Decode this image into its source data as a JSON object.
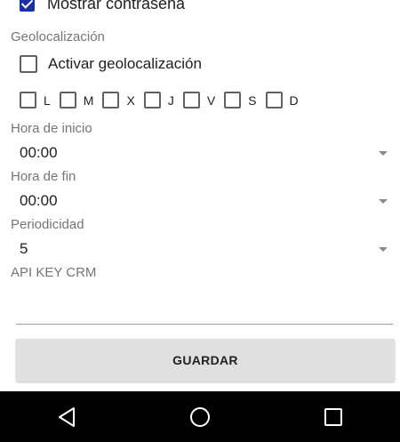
{
  "top_item": {
    "label": "Mostrar contraseña",
    "checked": true
  },
  "geolocation": {
    "section_label": "Geolocalización",
    "checkbox_label": "Activar geolocalización",
    "checked": false
  },
  "days": [
    {
      "label": "L",
      "checked": false
    },
    {
      "label": "M",
      "checked": false
    },
    {
      "label": "X",
      "checked": false
    },
    {
      "label": "J",
      "checked": false
    },
    {
      "label": "V",
      "checked": false
    },
    {
      "label": "S",
      "checked": false
    },
    {
      "label": "D",
      "checked": false
    }
  ],
  "start_time": {
    "label": "Hora de inicio",
    "value": "00:00"
  },
  "end_time": {
    "label": "Hora de fin",
    "value": "00:00"
  },
  "periodicity": {
    "label": "Periodicidad",
    "value": "5"
  },
  "api_key": {
    "label": "API KEY CRM",
    "value": ""
  },
  "save_button": {
    "label": "GUARDAR"
  },
  "navbar": {
    "icons": [
      "back-icon",
      "home-icon",
      "recents-icon"
    ]
  },
  "colors": {
    "checkbox_checked": "#1a2ea8",
    "label_gray": "#757575",
    "button_bg": "#e0e0e0",
    "navbar_bg": "#000000"
  }
}
